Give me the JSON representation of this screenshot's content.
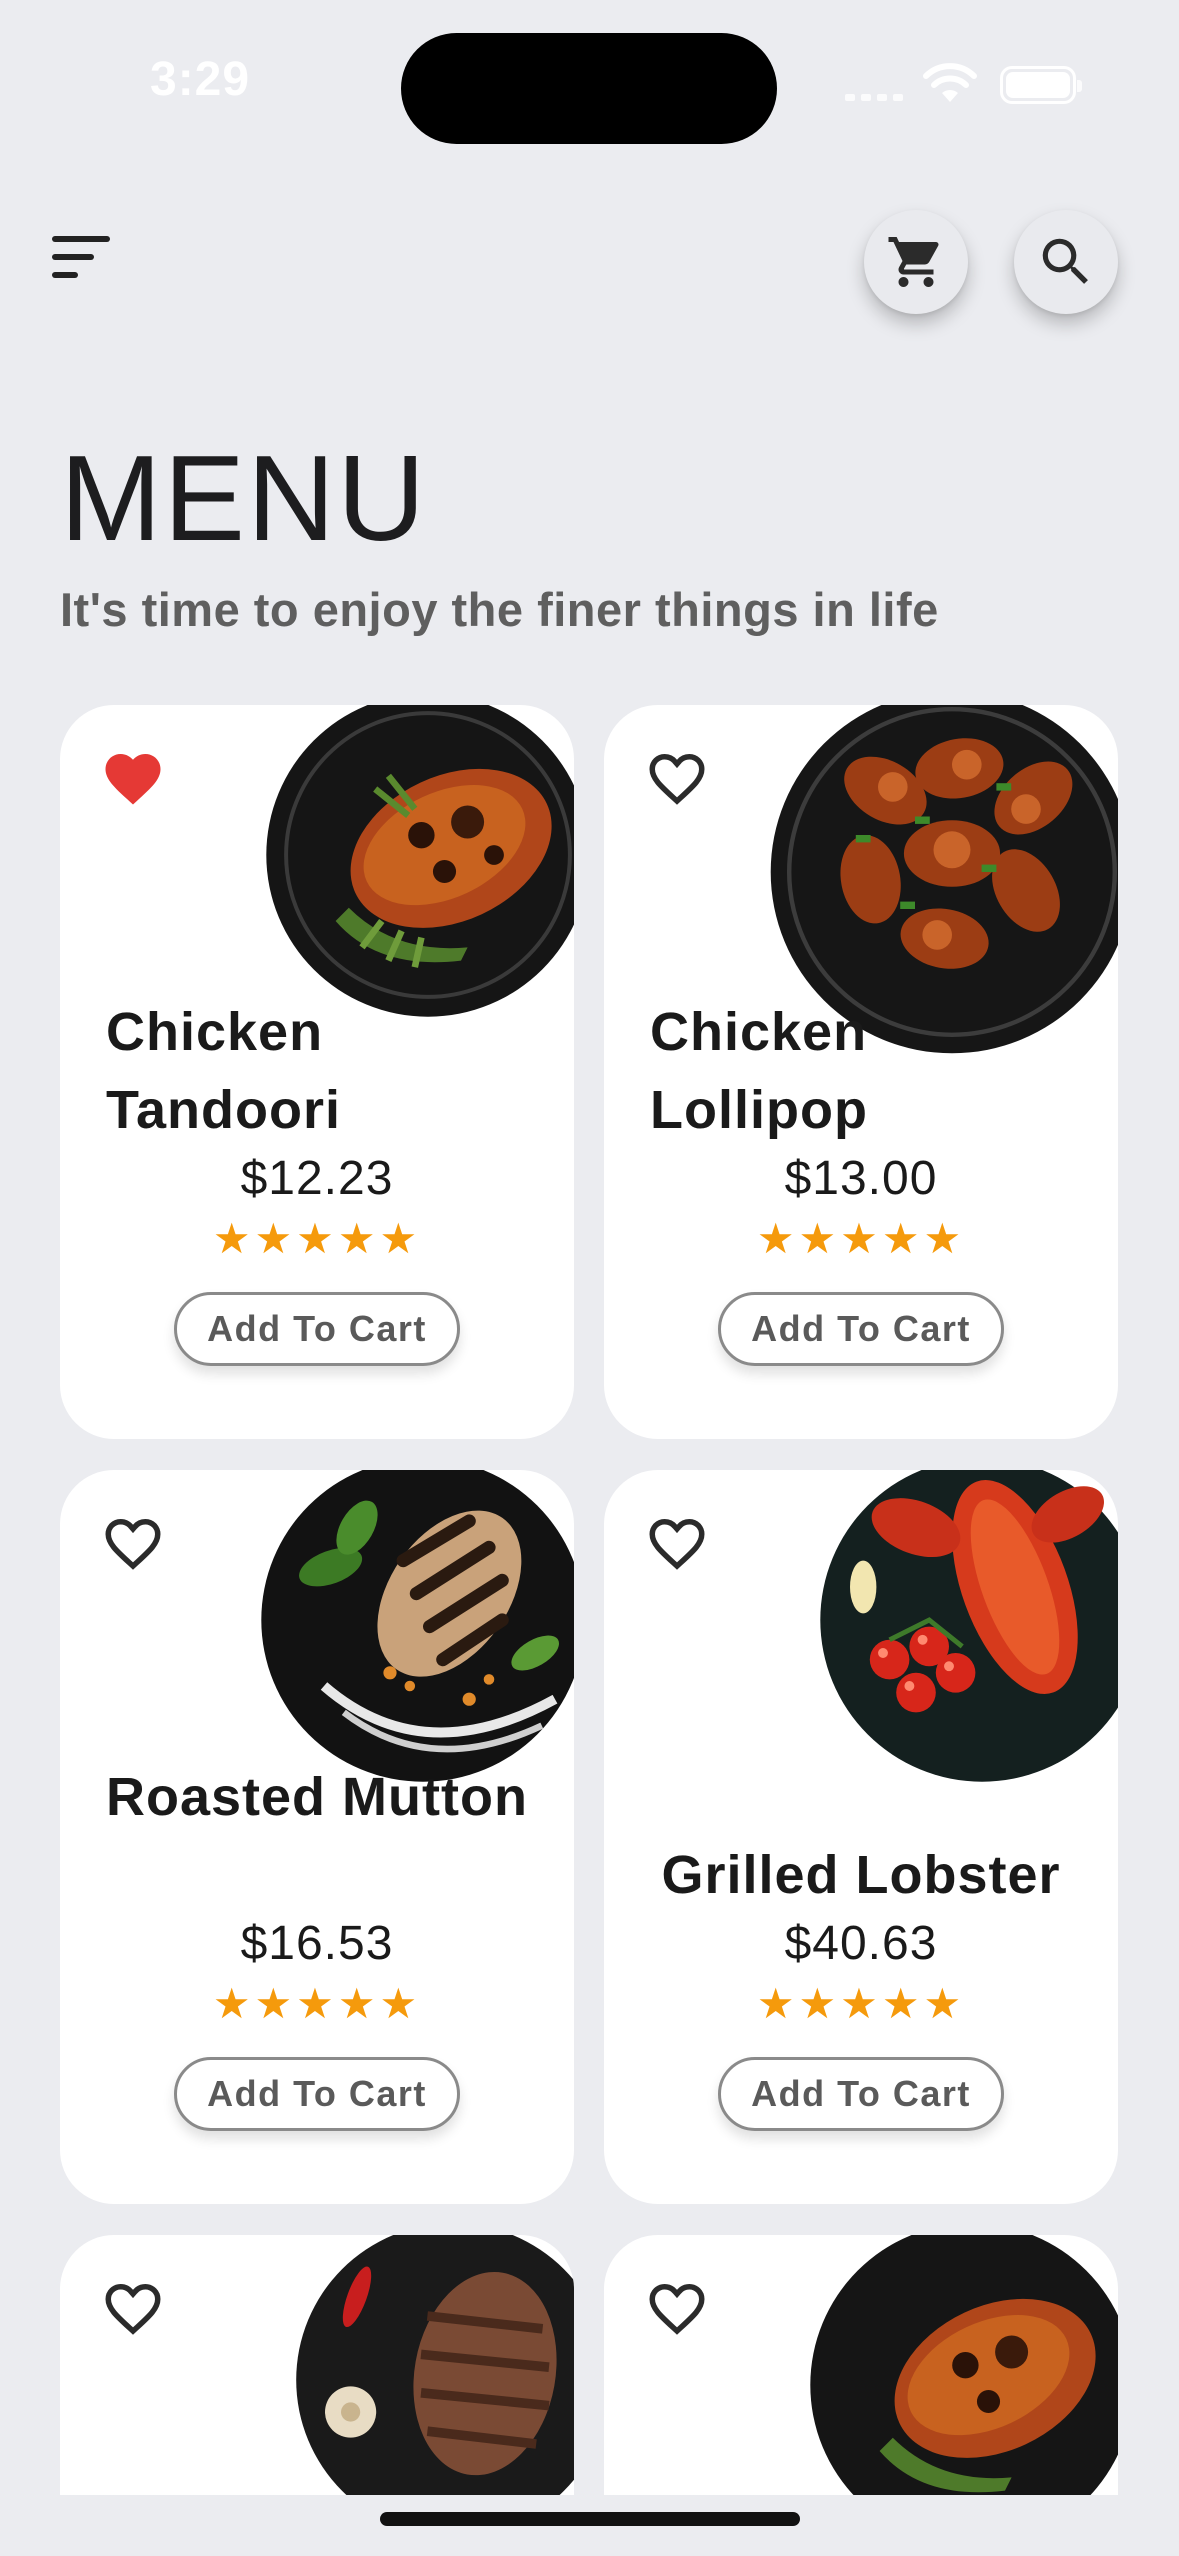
{
  "status_bar": {
    "time": "3:29"
  },
  "header": {
    "menu_icon": "menu-lines-icon",
    "cart_icon": "cart-icon",
    "search_icon": "search-icon"
  },
  "page": {
    "title": "MENU",
    "subtitle": "It's time to enjoy the finer things in life"
  },
  "colors": {
    "background": "#ebecf0",
    "card": "#ffffff",
    "favorite_active": "#e53935",
    "star": "#f59a0c"
  },
  "items": [
    {
      "name": "Chicken Tandoori",
      "price": "$12.23",
      "rating": 5,
      "favorite": true,
      "button": "Add To Cart"
    },
    {
      "name": "Chicken Lollipop",
      "price": "$13.00",
      "rating": 5,
      "favorite": false,
      "button": "Add To Cart"
    },
    {
      "name": "Roasted Mutton",
      "price": "$16.53",
      "rating": 5,
      "favorite": false,
      "button": "Add To Cart"
    },
    {
      "name": "Grilled Lobster",
      "price": "$40.63",
      "rating": 5,
      "favorite": false,
      "button": "Add To Cart"
    },
    {
      "favorite": false
    },
    {
      "favorite": false
    }
  ]
}
